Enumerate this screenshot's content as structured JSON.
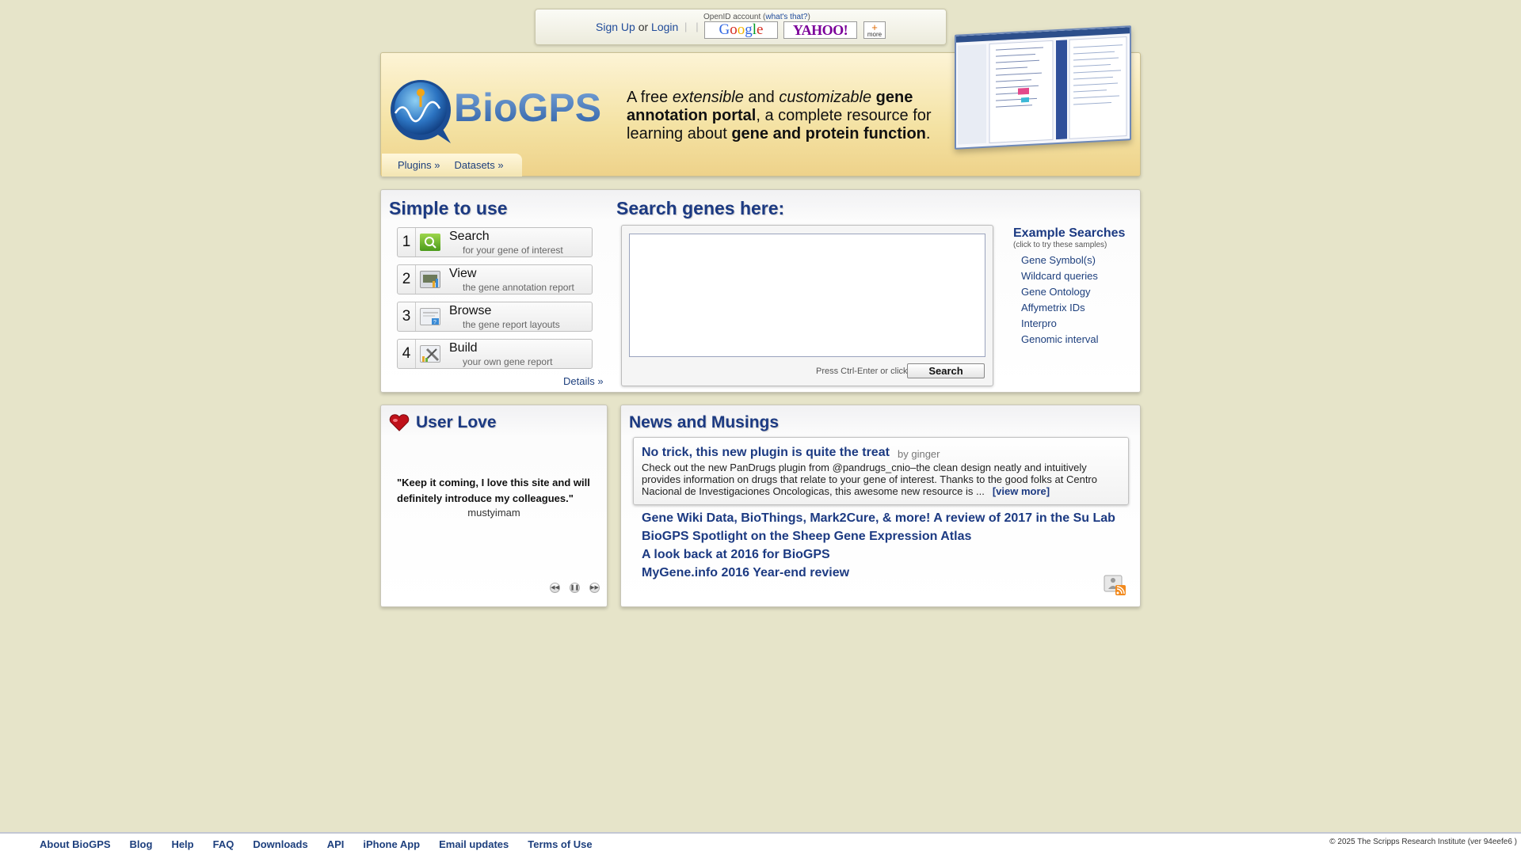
{
  "login": {
    "signup": "Sign Up",
    "or": "or",
    "login": "Login",
    "openid_caption": "OpenID account (",
    "openid_whats": "what's that?",
    "openid_close": ")",
    "providers": [
      "Google",
      "YAHOO!",
      "more"
    ]
  },
  "header": {
    "logo_text": "BioGPS",
    "tagline": {
      "p1": "A free ",
      "p2": "extensible",
      "p3": " and ",
      "p4": "customizable",
      "p5": " ",
      "p6": "gene annotation portal",
      "p7": ", a complete resource for learning about ",
      "p8": "gene and protein function",
      "p9": "."
    },
    "nav": [
      "Plugins »",
      "Datasets »"
    ]
  },
  "simple": {
    "title": "Simple to use",
    "steps": [
      {
        "num": "1",
        "title": "Search",
        "sub": "for your gene of interest",
        "icon": "search-icon"
      },
      {
        "num": "2",
        "title": "View",
        "sub": "the gene annotation report",
        "icon": "chart-icon"
      },
      {
        "num": "3",
        "title": "Browse",
        "sub": "the gene report layouts",
        "icon": "layout-icon"
      },
      {
        "num": "4",
        "title": "Build",
        "sub": "your own gene report",
        "icon": "tools-icon"
      }
    ],
    "details": "Details »"
  },
  "search": {
    "title": "Search genes here:",
    "query": "",
    "hint": "Press Ctrl-Enter or click",
    "button": "Search",
    "examples_title": "Example Searches",
    "examples_sub": "(click to try these samples)",
    "examples": [
      "Gene Symbol(s)",
      "Wildcard queries",
      "Gene Ontology",
      "Affymetrix IDs",
      "Interpro",
      "Genomic interval"
    ]
  },
  "userlove": {
    "title": "User Love",
    "quote": "\"Keep it coming, I love this site and will definitely introduce my colleagues.\"",
    "author": "mustyimam",
    "controls": [
      "prev",
      "pause",
      "next"
    ]
  },
  "news": {
    "title": "News and Musings",
    "featured": {
      "title": "No trick, this new plugin is quite the treat",
      "by": "by ginger",
      "body": "Check out the new PanDrugs plugin from @pandrugs_cnio–the clean design neatly and intuitively provides information on drugs that relate to your gene of interest. Thanks to the good folks at Centro Nacional de Investigaciones Oncologicas, this awesome new resource is ...",
      "more": "[view more]"
    },
    "items": [
      "Gene Wiki Data, BioThings, Mark2Cure, & more! A review of 2017 in the Su Lab",
      "BioGPS Spotlight on the Sheep Gene Expression Atlas",
      "A look back at 2016 for BioGPS",
      "MyGene.info 2016 Year-end review"
    ]
  },
  "footer": {
    "links": [
      "About BioGPS",
      "Blog",
      "Help",
      "FAQ",
      "Downloads",
      "API",
      "iPhone App",
      "Email updates",
      "Terms of Use"
    ],
    "copyright": "© 2025 The Scripps Research Institute (ver 94eefe6 )"
  },
  "colors": {
    "background": "#e6e4c9",
    "accent": "#1c3a82",
    "header_gold": "#f4e2a3"
  }
}
